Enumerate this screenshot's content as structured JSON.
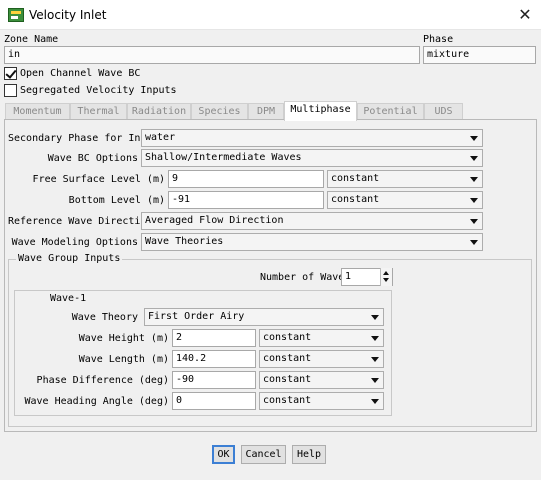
{
  "window": {
    "title": "Velocity Inlet",
    "close_glyph": "✕"
  },
  "zone": {
    "name_label": "Zone Name",
    "name_value": "in",
    "phase_label": "Phase",
    "phase_value": "mixture"
  },
  "options": {
    "open_channel_label": "Open Channel Wave BC",
    "open_channel_checked": true,
    "segregated_label": "Segregated Velocity Inputs",
    "segregated_checked": false
  },
  "tabs": [
    {
      "label": "Momentum",
      "active": false
    },
    {
      "label": "Thermal",
      "active": false
    },
    {
      "label": "Radiation",
      "active": false
    },
    {
      "label": "Species",
      "active": false
    },
    {
      "label": "DPM",
      "active": false
    },
    {
      "label": "Multiphase",
      "active": true
    },
    {
      "label": "Potential",
      "active": false
    },
    {
      "label": "UDS",
      "active": false
    }
  ],
  "multiphase": {
    "secondary_phase": {
      "label": "Secondary Phase for Inlet",
      "value": "water"
    },
    "wave_bc": {
      "label": "Wave BC Options",
      "value": "Shallow/Intermediate Waves"
    },
    "free_surface": {
      "label": "Free Surface Level (m)",
      "value": "9",
      "method": "constant"
    },
    "bottom_level": {
      "label": "Bottom Level (m)",
      "value": "-91",
      "method": "constant"
    },
    "ref_direction": {
      "label": "Reference Wave Direction",
      "value": "Averaged Flow Direction"
    },
    "modeling": {
      "label": "Wave Modeling Options",
      "value": "Wave Theories"
    }
  },
  "wave_group": {
    "title": "Wave Group Inputs",
    "num_waves_label": "Number of Waves",
    "num_waves_value": "1",
    "wave1": {
      "title": "Wave-1",
      "theory": {
        "label": "Wave Theory",
        "value": "First Order Airy"
      },
      "height": {
        "label": "Wave Height (m)",
        "value": "2",
        "method": "constant"
      },
      "length": {
        "label": "Wave Length (m)",
        "value": "140.2",
        "method": "constant"
      },
      "phase_diff": {
        "label": "Phase Difference (deg)",
        "value": "-90",
        "method": "constant"
      },
      "heading": {
        "label": "Wave Heading Angle (deg)",
        "value": "0",
        "method": "constant"
      }
    }
  },
  "buttons": {
    "ok": "OK",
    "cancel": "Cancel",
    "help": "Help"
  }
}
